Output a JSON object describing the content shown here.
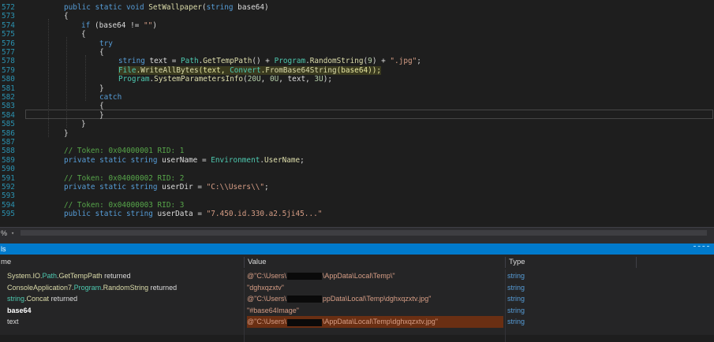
{
  "editor": {
    "lines": [
      {
        "n": "572",
        "html": "<span class='kw'>public static void</span> <span class='fn'>SetWallpaper</span>(<span class='kw'>string</span> base64)",
        "indent": 44
      },
      {
        "n": "573",
        "html": "{",
        "indent": 44
      },
      {
        "n": "574",
        "html": "<span class='kw'>if</span> (base64 != <span class='str'>\"\"</span>)",
        "indent": 66
      },
      {
        "n": "575",
        "html": "{",
        "indent": 66
      },
      {
        "n": "576",
        "html": "<span class='kw'>try</span>",
        "indent": 89
      },
      {
        "n": "577",
        "html": "{",
        "indent": 89
      },
      {
        "n": "578",
        "html": "<span class='kw'>string</span> text = <span class='ty'>Path</span>.<span class='fn'>GetTempPath</span>() + <span class='ty'>Program</span>.<span class='fn'>RandomString</span>(<span class='num'>9</span>) + <span class='str'>\".jpg\"</span>;",
        "indent": 113
      },
      {
        "n": "579",
        "html": "<span class='hl'><span class='ty'>File</span>.<span class='fn'>WriteAllBytes</span>(text, <span class='ty'>Convert</span>.<span class='fn'>FromBase64String</span>(base64));</span>",
        "indent": 113
      },
      {
        "n": "580",
        "html": "<span class='ty'>Program</span>.<span class='fn'>SystemParametersInfo</span>(<span class='num'>20U</span>, <span class='num'>0U</span>, text, <span class='num'>3U</span>);",
        "indent": 113
      },
      {
        "n": "581",
        "html": "}",
        "indent": 89
      },
      {
        "n": "582",
        "html": "<span class='kw'>catch</span>",
        "indent": 89
      },
      {
        "n": "583",
        "html": "{",
        "indent": 89
      },
      {
        "n": "584",
        "html": "}",
        "indent": 89
      },
      {
        "n": "585",
        "html": "}",
        "indent": 66
      },
      {
        "n": "586",
        "html": "}",
        "indent": 44
      },
      {
        "n": "587",
        "html": "",
        "indent": 44
      },
      {
        "n": "588",
        "html": "<span class='cm'>// Token: 0x04000001 RID: 1</span>",
        "indent": 44
      },
      {
        "n": "589",
        "html": "<span class='kw'>private static string</span> userName = <span class='ty'>Environment</span>.<span class='fn'>UserName</span>;",
        "indent": 44
      },
      {
        "n": "590",
        "html": "",
        "indent": 44
      },
      {
        "n": "591",
        "html": "<span class='cm'>// Token: 0x04000002 RID: 2</span>",
        "indent": 44
      },
      {
        "n": "592",
        "html": "<span class='kw'>private static string</span> userDir = <span class='str'>\"C:\\\\Users\\\\\"</span>;",
        "indent": 44
      },
      {
        "n": "593",
        "html": "",
        "indent": 44
      },
      {
        "n": "594",
        "html": "<span class='cm'>// Token: 0x04000003 RID: 3</span>",
        "indent": 44
      },
      {
        "n": "595",
        "html": "<span class='kw'>public static string</span> userData = <span class='str'>\"7.450.id.330.a2.5ji45...\"</span>",
        "indent": 44
      }
    ]
  },
  "zoombar": {
    "zoom_label": "%",
    "dropdown": "▾"
  },
  "autos": {
    "title": "ls",
    "headers": {
      "name": "me",
      "value": "Value",
      "type": "Type"
    },
    "rows": [
      {
        "name_html": "<span class='nm-y'>System.IO.</span><span class='nm-tyy'>Path</span><span class='nm-ns'>.</span><span class='nm-meth'>GetTempPath</span><span class='nm-ret'> returned</span>",
        "value_html": "@\"C:\\Users\\<span class='redact'></span>\\AppData\\Local\\Temp\\\"",
        "type": "string"
      },
      {
        "name_html": "<span class='nm-y'>ConsoleApplication7.</span><span class='nm-tyy'>Program</span><span class='nm-ns'>.</span><span class='nm-meth'>RandomString</span><span class='nm-ret'> returned</span>",
        "value_html": "\"dghxqzxtv\"",
        "type": "string"
      },
      {
        "name_html": "<span class='nm-c'>string</span><span class='nm-ns'>.</span><span class='nm-meth'>Concat</span><span class='nm-ret'> returned</span>",
        "value_html": "@\"C:\\Users\\<span class='redact'></span>ppData\\Local\\Temp\\dghxqzxtv.jpg\"",
        "type": "string"
      },
      {
        "name_html": "<span class='nm-b'>base64</span>",
        "value_html": "\"#base64Image\"",
        "type": "string"
      },
      {
        "name_html": "<span class='nm-w'>text</span>",
        "value_html": "@\"C:\\Users\\<span class='redact'></span>\\AppData\\Local\\Temp\\dghxqzxtv.jpg\"",
        "type": "string"
      }
    ]
  }
}
